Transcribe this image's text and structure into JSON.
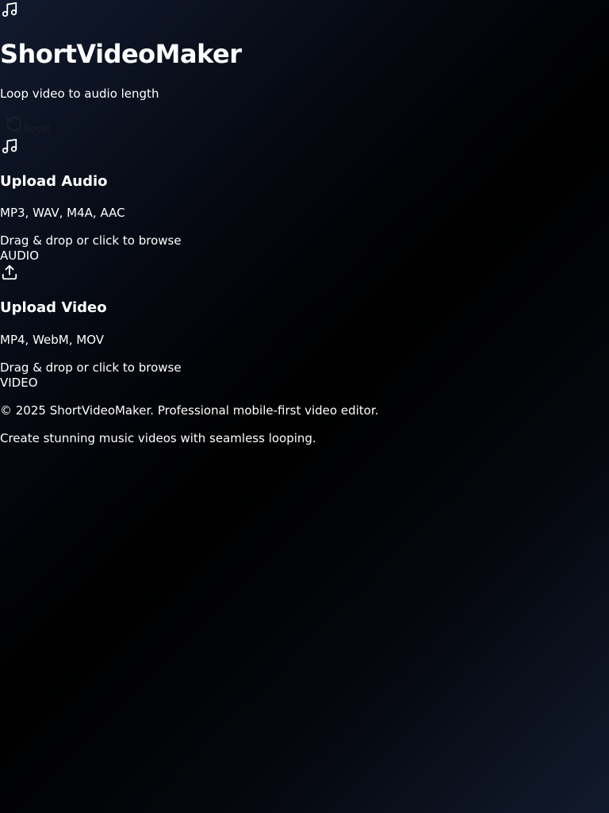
{
  "header": {
    "logo_icon": "music-note-icon",
    "title": "ShortVideoMaker",
    "subtitle": "Loop video to audio length",
    "reset_label": "Reset",
    "reset_icon": "rotate-ccw-icon"
  },
  "audio_upload": {
    "icon": "music-note-icon",
    "title": "Upload Audio",
    "formats": "MP3, WAV, M4A, AAC",
    "hint": "Drag & drop or click to browse",
    "tag": "AUDIO"
  },
  "video_upload": {
    "icon": "upload-icon",
    "title": "Upload Video",
    "formats": "MP4, WebM, MOV",
    "hint": "Drag & drop or click to browse",
    "tag": "VIDEO"
  },
  "footer": {
    "copyright": "© 2025 ShortVideoMaker. Professional mobile-first video editor.",
    "tagline": "Create stunning music videos with seamless looping."
  },
  "colors": {
    "background_dark": "#000000",
    "background_navy": "#111a2e",
    "text": "#ffffff",
    "reset_text": "#1c1f26"
  }
}
